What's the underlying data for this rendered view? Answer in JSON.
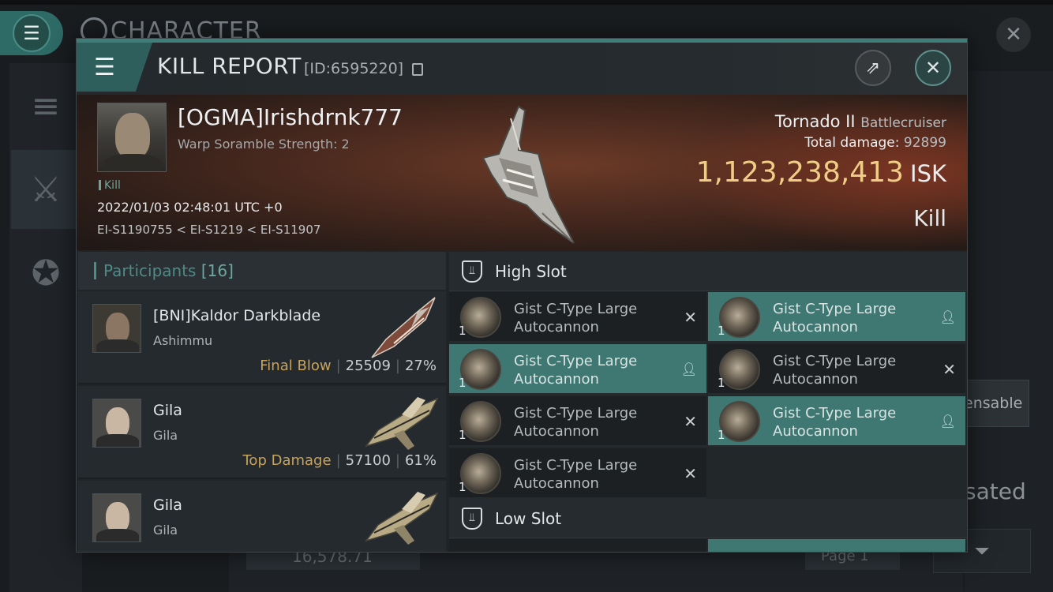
{
  "background": {
    "title": "CHARACTER",
    "side_button": "ensable",
    "side_text": "sated",
    "isk_balance": "16,578.71",
    "page_label": "Page 1"
  },
  "modal": {
    "title": "KILL REPORT",
    "report_id": "[ID:6595220]"
  },
  "victim": {
    "name": "[OGMA]Irishdrnk777",
    "warp_scramble": "Warp Soramble Strength: 2",
    "kill_tag": "Kill",
    "datetime": "2022/01/03 02:48:01 UTC +0",
    "system_path": "EI-S1190755 < EI-S1219 < EI-S11907",
    "ship_name": "Tornado II",
    "ship_class": "Battlecruiser",
    "total_damage_label": "Total damage:",
    "total_damage": "92899",
    "isk_value": "1,123,238,413",
    "isk_unit": "ISK",
    "result": "Kill"
  },
  "participants": {
    "title": "Participants",
    "count": "[16]",
    "rows": [
      {
        "name": "[BNI]Kaldor Darkblade",
        "ship": "Ashimmu",
        "tag": "Final Blow",
        "damage": "25509",
        "percent": "27%"
      },
      {
        "name": "Gila",
        "ship": "Gila",
        "tag": "Top Damage",
        "damage": "57100",
        "percent": "61%"
      },
      {
        "name": "Gila",
        "ship": "Gila",
        "tag": "",
        "damage": "",
        "percent": ""
      }
    ]
  },
  "fittings": {
    "high_slot_title": "High Slot",
    "low_slot_title": "Low Slot",
    "high_slot_items": [
      {
        "name_line1": "Gist C-Type Large",
        "name_line2": "Autocannon",
        "qty": "1",
        "dropped": false
      },
      {
        "name_line1": "Gist C-Type Large",
        "name_line2": "Autocannon",
        "qty": "1",
        "dropped": true
      },
      {
        "name_line1": "Gist C-Type Large",
        "name_line2": "Autocannon",
        "qty": "1",
        "dropped": true
      },
      {
        "name_line1": "Gist C-Type Large",
        "name_line2": "Autocannon",
        "qty": "1",
        "dropped": false
      },
      {
        "name_line1": "Gist C-Type Large",
        "name_line2": "Autocannon",
        "qty": "1",
        "dropped": false
      },
      {
        "name_line1": "Gist C-Type Large",
        "name_line2": "Autocannon",
        "qty": "1",
        "dropped": true
      },
      {
        "name_line1": "Gist C-Type Large",
        "name_line2": "Autocannon",
        "qty": "1",
        "dropped": false
      }
    ]
  },
  "icons": {
    "menu": "hamburger-menu-icon",
    "share": "share-icon",
    "close": "close-icon",
    "copy": "copy-icon",
    "slot": "slot-shield-icon",
    "destroyed": "x-icon",
    "dropped": "person-icon"
  },
  "colors": {
    "accent": "#3f7873",
    "isk_gold": "#f0cd86",
    "tag_gold": "#c7a35b",
    "participants_teal": "#4e8b86"
  }
}
